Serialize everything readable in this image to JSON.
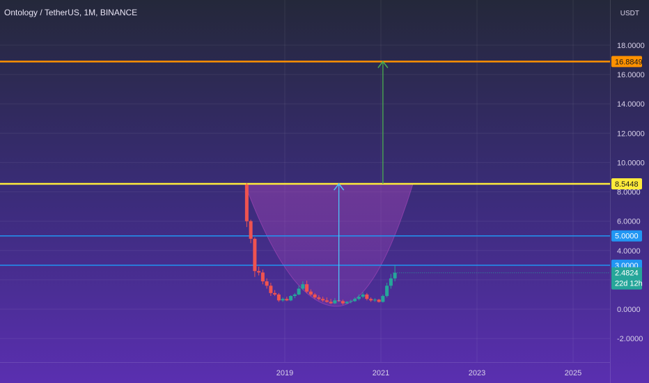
{
  "chart_data": {
    "type": "candlestick",
    "title": "Ontology / TetherUS, 1M, BINANCE",
    "price_unit": "USDT",
    "ylim": [
      -3.6,
      21
    ],
    "y_ticks": [
      -2,
      0,
      2,
      4,
      6,
      8,
      10,
      12,
      14,
      16,
      18
    ],
    "y_tick_labels": [
      "-2.0000",
      "0.0000",
      "",
      "4.0000",
      "6.0000",
      "8.0000",
      "10.0000",
      "12.0000",
      "14.0000",
      "16.0000",
      "18.0000"
    ],
    "x_range": [
      "2018-01",
      "2026-02"
    ],
    "x_ticks": [
      "2019",
      "2021",
      "2023",
      "2025"
    ],
    "grid": true,
    "candles": [
      {
        "t": "2018-03",
        "o": 8.5,
        "h": 8.6,
        "l": 5.6,
        "c": 6.0
      },
      {
        "t": "2018-04",
        "o": 6.0,
        "h": 6.1,
        "l": 4.5,
        "c": 4.8
      },
      {
        "t": "2018-05",
        "o": 4.8,
        "h": 4.9,
        "l": 2.2,
        "c": 2.6
      },
      {
        "t": "2018-06",
        "o": 2.6,
        "h": 2.9,
        "l": 2.3,
        "c": 2.5
      },
      {
        "t": "2018-07",
        "o": 2.5,
        "h": 2.7,
        "l": 1.7,
        "c": 1.9
      },
      {
        "t": "2018-08",
        "o": 1.9,
        "h": 2.1,
        "l": 1.4,
        "c": 1.6
      },
      {
        "t": "2018-09",
        "o": 1.6,
        "h": 1.8,
        "l": 0.9,
        "c": 1.1
      },
      {
        "t": "2018-10",
        "o": 1.1,
        "h": 1.3,
        "l": 0.9,
        "c": 1.0
      },
      {
        "t": "2018-11",
        "o": 1.0,
        "h": 1.1,
        "l": 0.5,
        "c": 0.6
      },
      {
        "t": "2018-12",
        "o": 0.6,
        "h": 0.8,
        "l": 0.5,
        "c": 0.7
      },
      {
        "t": "2019-01",
        "o": 0.7,
        "h": 0.85,
        "l": 0.55,
        "c": 0.6
      },
      {
        "t": "2019-02",
        "o": 0.6,
        "h": 0.95,
        "l": 0.55,
        "c": 0.9
      },
      {
        "t": "2019-03",
        "o": 0.9,
        "h": 1.1,
        "l": 0.75,
        "c": 1.0
      },
      {
        "t": "2019-04",
        "o": 1.0,
        "h": 1.6,
        "l": 0.95,
        "c": 1.4
      },
      {
        "t": "2019-05",
        "o": 1.4,
        "h": 1.9,
        "l": 1.3,
        "c": 1.7
      },
      {
        "t": "2019-06",
        "o": 1.7,
        "h": 1.95,
        "l": 1.1,
        "c": 1.2
      },
      {
        "t": "2019-07",
        "o": 1.2,
        "h": 1.35,
        "l": 0.9,
        "c": 1.0
      },
      {
        "t": "2019-08",
        "o": 1.0,
        "h": 1.1,
        "l": 0.7,
        "c": 0.8
      },
      {
        "t": "2019-09",
        "o": 0.8,
        "h": 0.95,
        "l": 0.6,
        "c": 0.7
      },
      {
        "t": "2019-10",
        "o": 0.7,
        "h": 0.85,
        "l": 0.5,
        "c": 0.6
      },
      {
        "t": "2019-11",
        "o": 0.6,
        "h": 0.8,
        "l": 0.45,
        "c": 0.5
      },
      {
        "t": "2019-12",
        "o": 0.5,
        "h": 0.7,
        "l": 0.35,
        "c": 0.4
      },
      {
        "t": "2020-01",
        "o": 0.4,
        "h": 0.75,
        "l": 0.35,
        "c": 0.6
      },
      {
        "t": "2020-02",
        "o": 0.6,
        "h": 0.9,
        "l": 0.5,
        "c": 0.55
      },
      {
        "t": "2020-03",
        "o": 0.55,
        "h": 0.65,
        "l": 0.3,
        "c": 0.4
      },
      {
        "t": "2020-04",
        "o": 0.4,
        "h": 0.55,
        "l": 0.35,
        "c": 0.5
      },
      {
        "t": "2020-05",
        "o": 0.5,
        "h": 0.65,
        "l": 0.4,
        "c": 0.55
      },
      {
        "t": "2020-06",
        "o": 0.55,
        "h": 0.8,
        "l": 0.5,
        "c": 0.7
      },
      {
        "t": "2020-07",
        "o": 0.7,
        "h": 1.0,
        "l": 0.6,
        "c": 0.85
      },
      {
        "t": "2020-08",
        "o": 0.85,
        "h": 1.15,
        "l": 0.75,
        "c": 1.0
      },
      {
        "t": "2020-09",
        "o": 1.0,
        "h": 1.1,
        "l": 0.6,
        "c": 0.7
      },
      {
        "t": "2020-10",
        "o": 0.7,
        "h": 0.8,
        "l": 0.5,
        "c": 0.6
      },
      {
        "t": "2020-11",
        "o": 0.6,
        "h": 0.75,
        "l": 0.5,
        "c": 0.65
      },
      {
        "t": "2020-12",
        "o": 0.65,
        "h": 0.7,
        "l": 0.45,
        "c": 0.5
      },
      {
        "t": "2021-01",
        "o": 0.5,
        "h": 1.0,
        "l": 0.45,
        "c": 0.9
      },
      {
        "t": "2021-02",
        "o": 0.9,
        "h": 1.8,
        "l": 0.8,
        "c": 1.6
      },
      {
        "t": "2021-03",
        "o": 1.6,
        "h": 2.4,
        "l": 1.4,
        "c": 2.1
      },
      {
        "t": "2021-04",
        "o": 2.1,
        "h": 3.0,
        "l": 1.9,
        "c": 2.48
      }
    ],
    "horizontal_levels": [
      {
        "price": 16.8849,
        "label": "16.8849",
        "color": "#ff9100"
      },
      {
        "price": 8.5448,
        "label": "8.5448",
        "color": "#ffeb3b"
      },
      {
        "price": 5.0,
        "label": "5.0000",
        "color": "#2196f3"
      },
      {
        "price": 3.0,
        "label": "3.0000",
        "color": "#2196f3"
      }
    ],
    "last_price": {
      "price": 2.4824,
      "label": "2.4824",
      "countdown": "22d 12h",
      "color": "#26a69a"
    },
    "arrows": [
      {
        "x": "2020-02",
        "from": 0.55,
        "to": 8.5448,
        "color": "#4fc3f7"
      },
      {
        "x": "2021-01",
        "from": 8.5448,
        "to": 16.8849,
        "color": "#4caf50"
      }
    ],
    "cup_shape": {
      "left": "2018-03",
      "bottom_x": "2020-02",
      "bottom_y": 0.2,
      "right": "2021-09",
      "top_y": 8.5448,
      "color": "#ab47bc"
    }
  },
  "colors": {
    "bg_top": "#24283a",
    "bg_bottom": "#5a2fb0",
    "up": "#26a69a",
    "down": "#ef5350",
    "grid": "#ffffff"
  }
}
